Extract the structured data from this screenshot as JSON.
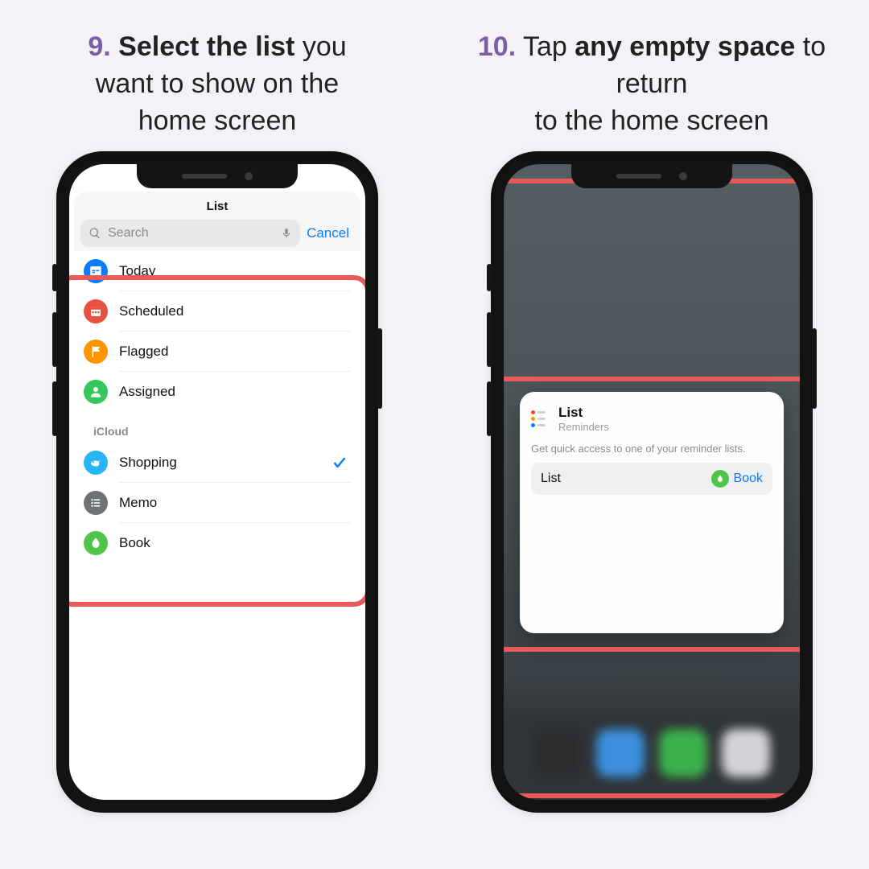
{
  "step9": {
    "num": "9.",
    "bold": "Select the list",
    "rest1": "you",
    "line2": "want to show on the",
    "line3": "home screen",
    "sheet_title": "List",
    "search_placeholder": "Search",
    "cancel": "Cancel",
    "smart_lists": [
      {
        "label": "Today",
        "color": "#0a7cff",
        "type": "today"
      },
      {
        "label": "Scheduled",
        "color": "#e8513e",
        "type": "scheduled"
      },
      {
        "label": "Flagged",
        "color": "#ff9500",
        "type": "flagged"
      },
      {
        "label": "Assigned",
        "color": "#34c759",
        "type": "assigned"
      }
    ],
    "section": "iCloud",
    "user_lists": [
      {
        "label": "Shopping",
        "color": "#29b6f6",
        "type": "fish",
        "selected": true
      },
      {
        "label": "Memo",
        "color": "#6e7175",
        "type": "lines",
        "selected": false
      },
      {
        "label": "Book",
        "color": "#4fc64a",
        "type": "drop",
        "selected": false
      }
    ]
  },
  "step10": {
    "num": "10.",
    "pre": "Tap",
    "bold": "any empty space",
    "rest1": "to return",
    "line2": "to the home screen",
    "widget": {
      "title": "List",
      "subtitle": "Reminders",
      "desc": "Get quick access to one of your reminder lists.",
      "row_label": "List",
      "row_value": "Book",
      "value_color": "#4fc64a"
    }
  }
}
